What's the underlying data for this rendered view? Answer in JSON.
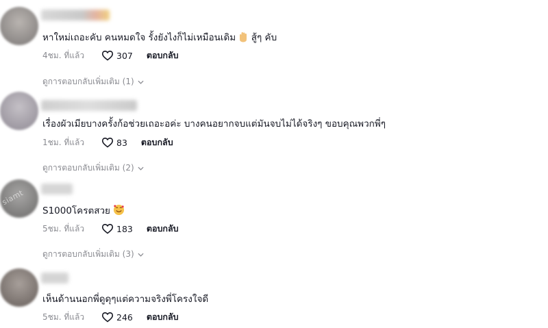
{
  "comments": [
    {
      "text": "หาใหม่เถอะคับ คนหมดใจ รั้งยังไงก็ไม่เหมือนเดิม",
      "text_suffix": "สู้ๆ คับ",
      "time": "4ชม. ที่แล้ว",
      "likes": "307",
      "reply_label": "ตอบกลับ",
      "more_replies": "ดูการตอบกลับเพิ่มเติม (1)"
    },
    {
      "text": "เรื่องผัวเมียบางครั้งก้อช่วยเถอะอค่ะ บางคนอยากจบแต่มันจบไม่ได้จริงๆ ขอบคุณพวกพี่ๆ",
      "time": "1ชม. ที่แล้ว",
      "likes": "83",
      "reply_label": "ตอบกลับ",
      "more_replies": "ดูการตอบกลับเพิ่มเติม (2)"
    },
    {
      "text": "S1000โครตสวย",
      "time": "5ชม. ที่แล้ว",
      "likes": "183",
      "reply_label": "ตอบกลับ",
      "more_replies": "ดูการตอบกลับเพิ่มเติม (3)"
    },
    {
      "text": "เห็นด้านนอกพี่ดูดุๆแต่ความจริงพี่โครงใจดี",
      "time": "5ชม. ที่แล้ว",
      "likes": "246",
      "reply_label": "ตอบกลับ"
    }
  ],
  "watermark": "siamt",
  "colors": {
    "text": "#161823",
    "meta": "#8a8b91"
  },
  "icons": {
    "like": "heart-outline-icon",
    "expand": "chevron-down-icon",
    "hand": "raised-hand-emoji",
    "smile": "smiling-hearts-emoji"
  }
}
